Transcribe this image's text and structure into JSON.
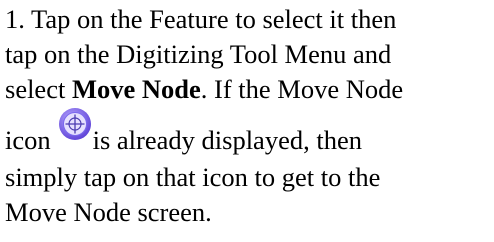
{
  "step": {
    "line1": "1. Tap on the Feature to select it then",
    "line2": "tap on the Digitizing Tool Menu and",
    "line3_before": "select ",
    "line3_bold": "Move Node",
    "line3_after": ". If the Move Node",
    "line4_before": "icon",
    "line4_after": "is already displayed, then",
    "line5": "simply tap on that icon to get to the",
    "line6": "Move Node screen."
  },
  "icon": {
    "name": "move-node-icon",
    "ring_color": "#6a5acd",
    "fill_color": "#e6e0ff"
  }
}
